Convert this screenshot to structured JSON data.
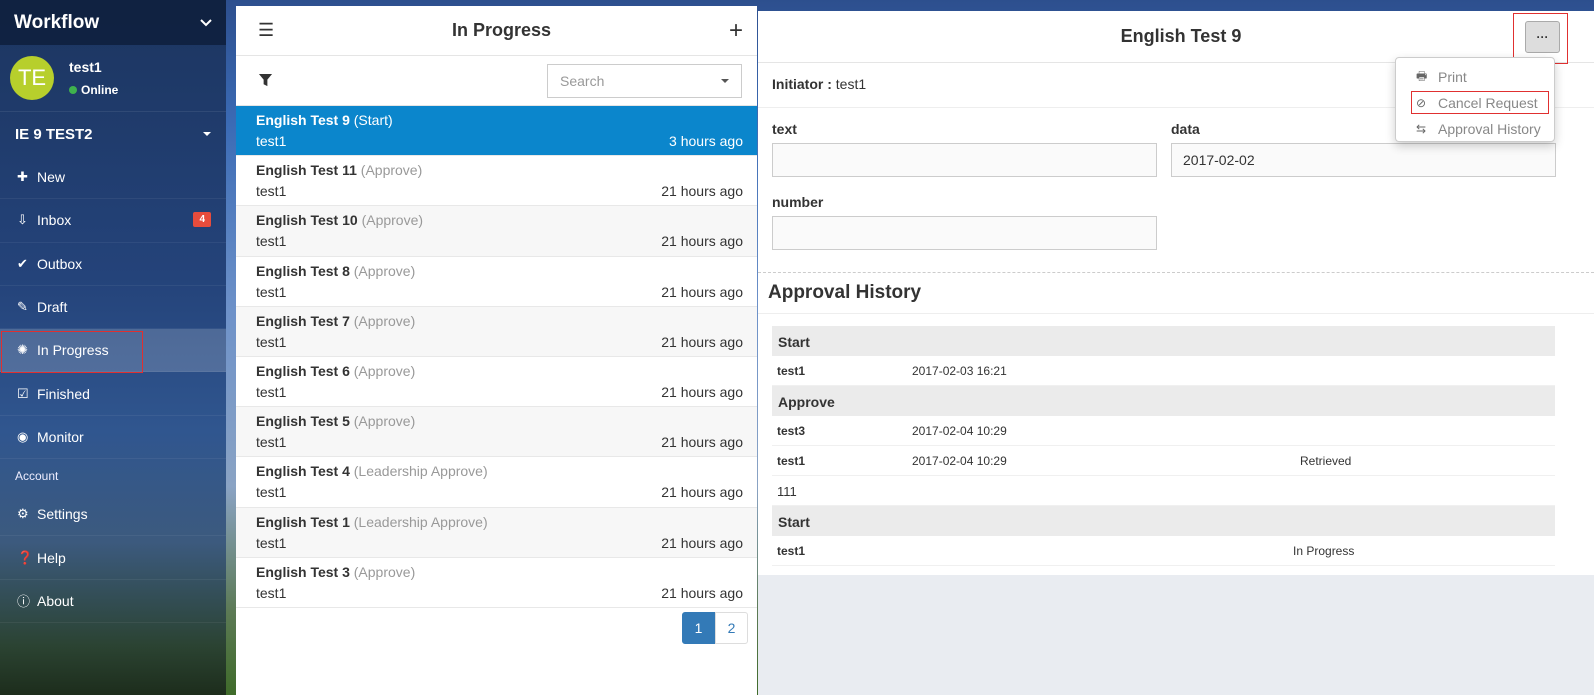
{
  "sidebar": {
    "brand": "Workflow",
    "user": {
      "initials": "TE",
      "name": "test1",
      "status": "Online"
    },
    "org": "IE 9 TEST2",
    "items": [
      {
        "label": "New",
        "icon": "plus-icon"
      },
      {
        "label": "Inbox",
        "icon": "inbox-icon",
        "badge": "4"
      },
      {
        "label": "Outbox",
        "icon": "check-double-icon"
      },
      {
        "label": "Draft",
        "icon": "edit-icon"
      },
      {
        "label": "In Progress",
        "icon": "spinner-icon"
      },
      {
        "label": "Finished",
        "icon": "checkbox-icon"
      },
      {
        "label": "Monitor",
        "icon": "eye-icon"
      }
    ],
    "section": "Account",
    "account_items": [
      {
        "label": "Settings",
        "icon": "gear-icon"
      },
      {
        "label": "Help",
        "icon": "question-icon"
      },
      {
        "label": "About",
        "icon": "info-icon"
      }
    ]
  },
  "list": {
    "title": "In Progress",
    "search_placeholder": "Search",
    "rows": [
      {
        "title": "English Test 9",
        "stage": "(Start)",
        "user": "test1",
        "time": "3 hours ago"
      },
      {
        "title": "English Test 11",
        "stage": "(Approve)",
        "user": "test1",
        "time": "21 hours ago"
      },
      {
        "title": "English Test 10",
        "stage": "(Approve)",
        "user": "test1",
        "time": "21 hours ago"
      },
      {
        "title": "English Test 8",
        "stage": "(Approve)",
        "user": "test1",
        "time": "21 hours ago"
      },
      {
        "title": "English Test 7",
        "stage": "(Approve)",
        "user": "test1",
        "time": "21 hours ago"
      },
      {
        "title": "English Test 6",
        "stage": "(Approve)",
        "user": "test1",
        "time": "21 hours ago"
      },
      {
        "title": "English Test 5",
        "stage": "(Approve)",
        "user": "test1",
        "time": "21 hours ago"
      },
      {
        "title": "English Test 4",
        "stage": "(Leadership Approve)",
        "user": "test1",
        "time": "21 hours ago"
      },
      {
        "title": "English Test 1",
        "stage": "(Leadership Approve)",
        "user": "test1",
        "time": "21 hours ago"
      },
      {
        "title": "English Test 3",
        "stage": "(Approve)",
        "user": "test1",
        "time": "21 hours ago"
      }
    ],
    "pages": [
      "1",
      "2"
    ]
  },
  "detail": {
    "title": "English Test 9",
    "more_label": "···",
    "initiator_label": "Initiator :",
    "initiator": "test1",
    "fields": {
      "text_label": "text",
      "text_value": "",
      "data_label": "data",
      "data_value": "2017-02-02",
      "number_label": "number",
      "number_value": ""
    },
    "history_title": "Approval History",
    "history": {
      "g1": "Start",
      "r1": {
        "who": "test1",
        "when": "2017-02-03 16:21",
        "status": ""
      },
      "g2": "Approve",
      "r2": {
        "who": "test3",
        "when": "2017-02-04 10:29",
        "status": ""
      },
      "r3": {
        "who": "test1",
        "when": "2017-02-04 10:29",
        "status": "Retrieved"
      },
      "r4": {
        "who": "111",
        "when": "",
        "status": ""
      },
      "g3": "Start",
      "r5": {
        "who": "test1",
        "when": "",
        "status": "In Progress"
      }
    }
  },
  "menu": {
    "print": "Print",
    "cancel": "Cancel Request",
    "history": "Approval History"
  }
}
